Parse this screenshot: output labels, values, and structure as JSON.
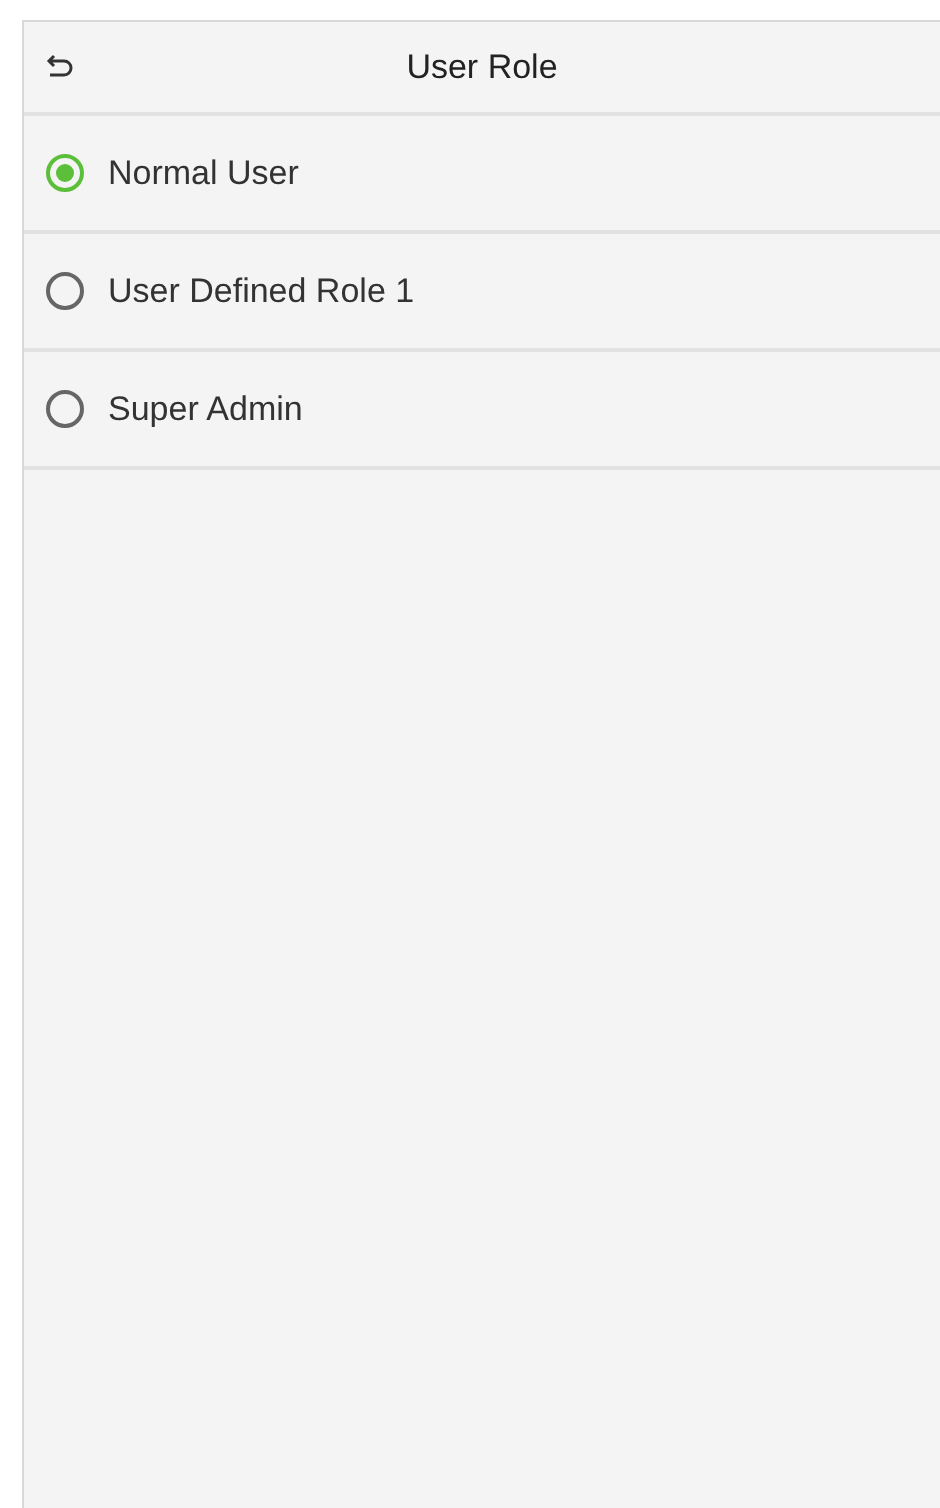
{
  "header": {
    "title": "User Role"
  },
  "options": [
    {
      "label": "Normal User",
      "selected": true
    },
    {
      "label": "User Defined Role 1",
      "selected": false
    },
    {
      "label": "Super Admin",
      "selected": false
    }
  ]
}
